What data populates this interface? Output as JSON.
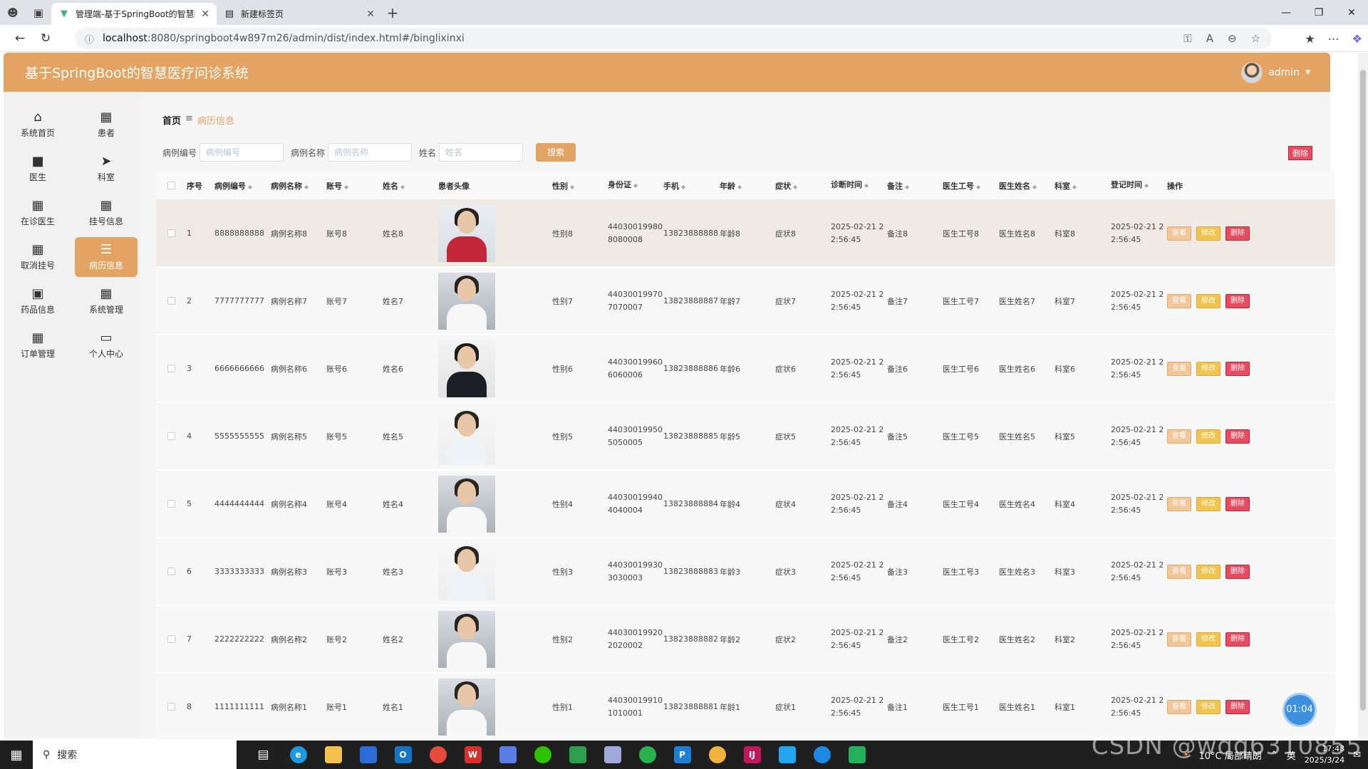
{
  "browser": {
    "tabs": [
      {
        "title": "管理端-基于SpringBoot的智慧医",
        "active": true
      },
      {
        "title": "新建标签页",
        "active": false
      }
    ],
    "url_host": "localhost",
    "url_rest": ":8080/springboot4w897m26/admin/dist/index.html#/binglixinxi"
  },
  "app": {
    "title": "基于SpringBoot的智慧医疗问诊系统",
    "user": "admin",
    "accent": "#e3a463"
  },
  "sidebar": {
    "items": [
      {
        "label": "系统首页",
        "icon": "home-icon"
      },
      {
        "label": "患者",
        "icon": "grid-icon"
      },
      {
        "label": "医生",
        "icon": "chat-icon"
      },
      {
        "label": "科室",
        "icon": "send-icon"
      },
      {
        "label": "在诊医生",
        "icon": "grid-icon"
      },
      {
        "label": "挂号信息",
        "icon": "grid-icon"
      },
      {
        "label": "取消挂号",
        "icon": "grid-icon"
      },
      {
        "label": "病历信息",
        "icon": "list-icon",
        "active": true
      },
      {
        "label": "药品信息",
        "icon": "monitor-icon"
      },
      {
        "label": "系统管理",
        "icon": "grid-icon"
      },
      {
        "label": "订单管理",
        "icon": "grid-icon"
      },
      {
        "label": "个人中心",
        "icon": "card-icon"
      }
    ]
  },
  "breadcrumb": {
    "home": "首页",
    "current": "病历信息"
  },
  "search": {
    "f1_label": "病例编号",
    "f1_placeholder": "病例编号",
    "f2_label": "病例名称",
    "f2_placeholder": "病例名称",
    "f3_label": "姓名",
    "f3_placeholder": "姓名",
    "button": "搜索"
  },
  "delete_all": "删除",
  "table": {
    "headers": [
      "序号",
      "病例编号",
      "病例名称",
      "账号",
      "姓名",
      "患者头像",
      "性别",
      "身份证",
      "手机",
      "年龄",
      "症状",
      "诊断时间",
      "备注",
      "医生工号",
      "医生姓名",
      "科室",
      "登记时间",
      "操作"
    ],
    "actions": {
      "view": "查看",
      "edit": "修改",
      "delete": "删除"
    },
    "rows": [
      {
        "no": "1",
        "bh": "8888888888",
        "mc": "病例名称8",
        "zh": "账号8",
        "xm": "姓名8",
        "xb": "性别8",
        "sfz1": "44030019980",
        "sfz2": "8080008",
        "sj": "13823888888",
        "nl": "年龄8",
        "zz": "症状8",
        "zd1": "2025-02-21 2",
        "zd2": "2:56:45",
        "bz": "备注8",
        "gh": "医生工号8",
        "ys": "医生姓名8",
        "ks": "科室8",
        "dj1": "2025-02-21 2",
        "dj2": "2:56:45",
        "photo": "red"
      },
      {
        "no": "2",
        "bh": "7777777777",
        "mc": "病例名称7",
        "zh": "账号7",
        "xm": "姓名7",
        "xb": "性别7",
        "sfz1": "44030019970",
        "sfz2": "7070007",
        "sj": "13823888887",
        "nl": "年龄7",
        "zz": "症状7",
        "zd1": "2025-02-21 2",
        "zd2": "2:56:45",
        "bz": "备注7",
        "gh": "医生工号7",
        "ys": "医生姓名7",
        "ks": "科室7",
        "dj1": "2025-02-21 2",
        "dj2": "2:56:45",
        "photo": "coat"
      },
      {
        "no": "3",
        "bh": "6666666666",
        "mc": "病例名称6",
        "zh": "账号6",
        "xm": "姓名6",
        "xb": "性别6",
        "sfz1": "44030019960",
        "sfz2": "6060006",
        "sj": "13823888886",
        "nl": "年龄6",
        "zz": "症状6",
        "zd1": "2025-02-21 2",
        "zd2": "2:56:45",
        "bz": "备注6",
        "gh": "医生工号6",
        "ys": "医生姓名6",
        "ks": "科室6",
        "dj1": "2025-02-21 2",
        "dj2": "2:56:45",
        "photo": "suit"
      },
      {
        "no": "4",
        "bh": "5555555555",
        "mc": "病例名称5",
        "zh": "账号5",
        "xm": "姓名5",
        "xb": "性别5",
        "sfz1": "44030019950",
        "sfz2": "5050005",
        "sj": "13823888885",
        "nl": "年龄5",
        "zz": "症状5",
        "zd1": "2025-02-21 2",
        "zd2": "2:56:45",
        "bz": "备注5",
        "gh": "医生工号5",
        "ys": "医生姓名5",
        "ks": "科室5",
        "dj1": "2025-02-21 2",
        "dj2": "2:56:45",
        "photo": "white"
      },
      {
        "no": "5",
        "bh": "4444444444",
        "mc": "病例名称4",
        "zh": "账号4",
        "xm": "姓名4",
        "xb": "性别4",
        "sfz1": "44030019940",
        "sfz2": "4040004",
        "sj": "13823888884",
        "nl": "年龄4",
        "zz": "症状4",
        "zd1": "2025-02-21 2",
        "zd2": "2:56:45",
        "bz": "备注4",
        "gh": "医生工号4",
        "ys": "医生姓名4",
        "ks": "科室4",
        "dj1": "2025-02-21 2",
        "dj2": "2:56:45",
        "photo": "coat"
      },
      {
        "no": "6",
        "bh": "3333333333",
        "mc": "病例名称3",
        "zh": "账号3",
        "xm": "姓名3",
        "xb": "性别3",
        "sfz1": "44030019930",
        "sfz2": "3030003",
        "sj": "13823888883",
        "nl": "年龄3",
        "zz": "症状3",
        "zd1": "2025-02-21 2",
        "zd2": "2:56:45",
        "bz": "备注3",
        "gh": "医生工号3",
        "ys": "医生姓名3",
        "ks": "科室3",
        "dj1": "2025-02-21 2",
        "dj2": "2:56:45",
        "photo": "white"
      },
      {
        "no": "7",
        "bh": "2222222222",
        "mc": "病例名称2",
        "zh": "账号2",
        "xm": "姓名2",
        "xb": "性别2",
        "sfz1": "44030019920",
        "sfz2": "2020002",
        "sj": "13823888882",
        "nl": "年龄2",
        "zz": "症状2",
        "zd1": "2025-02-21 2",
        "zd2": "2:56:45",
        "bz": "备注2",
        "gh": "医生工号2",
        "ys": "医生姓名2",
        "ks": "科室2",
        "dj1": "2025-02-21 2",
        "dj2": "2:56:45",
        "photo": "coat"
      },
      {
        "no": "8",
        "bh": "1111111111",
        "mc": "病例名称1",
        "zh": "账号1",
        "xm": "姓名1",
        "xb": "性别1",
        "sfz1": "44030019910",
        "sfz2": "1010001",
        "sj": "13823888881",
        "nl": "年龄1",
        "zz": "症状1",
        "zd1": "2025-02-21 2",
        "zd2": "2:56:45",
        "bz": "备注1",
        "gh": "医生工号1",
        "ys": "医生姓名1",
        "ks": "科室1",
        "dj1": "2025-02-21 2",
        "dj2": "2:56:45",
        "photo": "coat"
      }
    ]
  },
  "timer": "01:04",
  "taskbar": {
    "search": "搜索",
    "weather": "10°C 局部晴朗",
    "time": "17:48",
    "date": "2025/3/24",
    "ime": "英"
  },
  "watermark": "CSDN @wqq6310855"
}
